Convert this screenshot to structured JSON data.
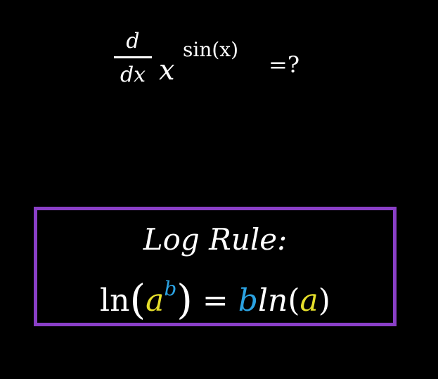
{
  "question": {
    "numerator": "d",
    "denominator": "dx",
    "base": "x",
    "exponent": "sin(x)",
    "equals_question": "=?"
  },
  "rule": {
    "title": "Log Rule:",
    "ln_left": "ln",
    "paren_open": "(",
    "a_left": "a",
    "b_left": "b",
    "paren_close": ")",
    "equals": " = ",
    "b_right": "b",
    "ln_right": "ln",
    "paren_open_right": "(",
    "a_right": "a",
    "paren_close_right": ")"
  },
  "colors": {
    "background": "#000000",
    "box_border": "#8a3fc7",
    "text": "#ffffff",
    "a_color": "#e6df2b",
    "b_color": "#2ba3e3"
  }
}
